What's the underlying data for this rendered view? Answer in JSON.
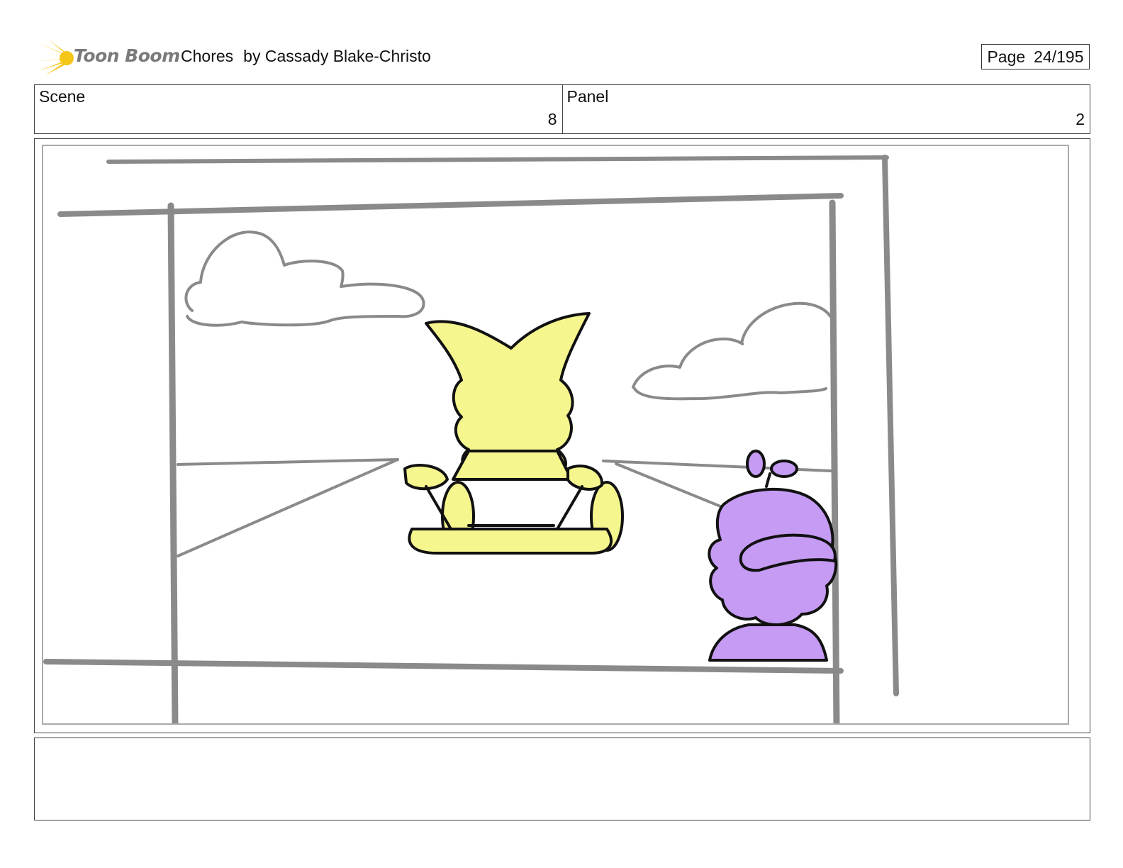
{
  "header": {
    "logo_text": "Toon Boom",
    "title": "Chores",
    "author": "by Cassady Blake-Christo",
    "page_label": "Page",
    "page_number": "24/195"
  },
  "info": {
    "scene_label": "Scene",
    "scene_value": "8",
    "panel_label": "Panel",
    "panel_value": "2"
  },
  "colors": {
    "logo_flare": "#f5c518",
    "sketch_gray": "#8a8a8a",
    "character_yellow": "#f6f68f",
    "character_purple": "#c59bf3",
    "ink": "#111111"
  },
  "notes": {
    "text": ""
  }
}
